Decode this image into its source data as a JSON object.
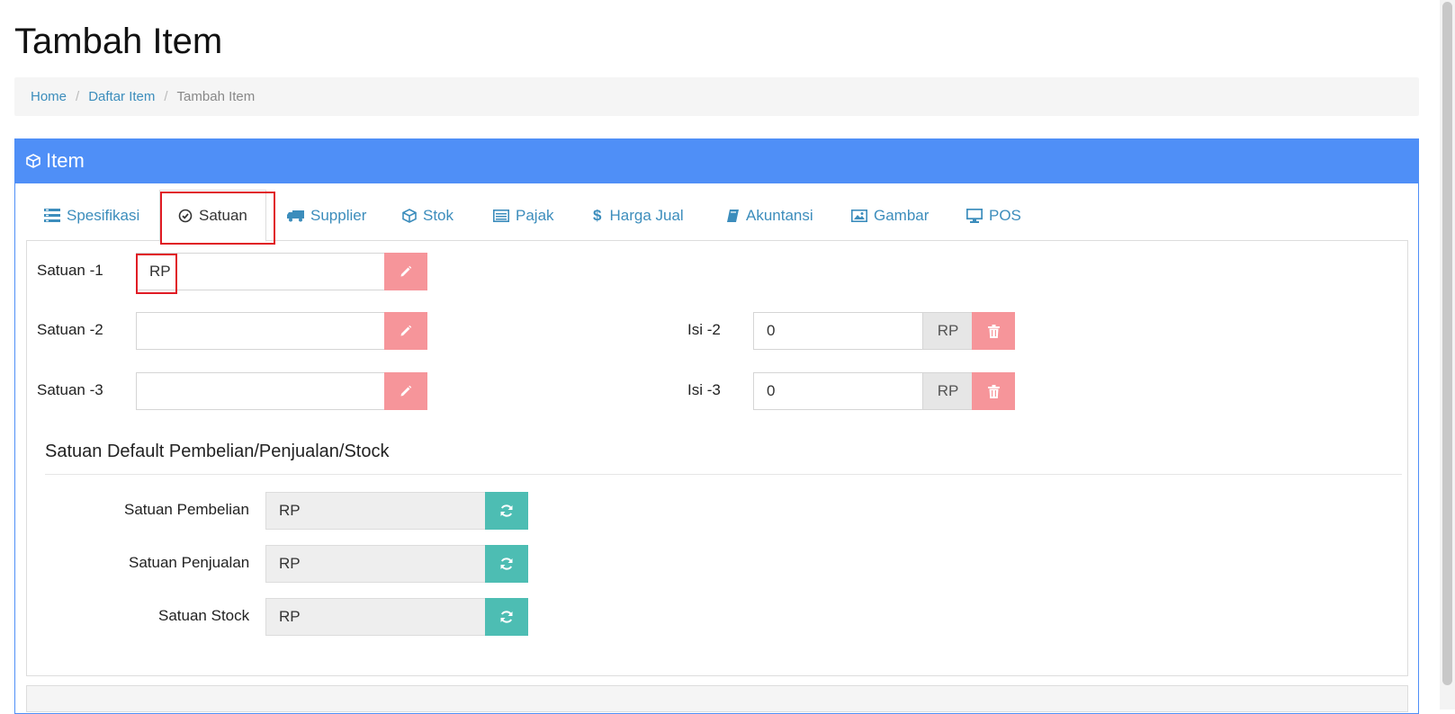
{
  "page": {
    "title": "Tambah Item"
  },
  "breadcrumb": {
    "items": [
      "Home",
      "Daftar Item"
    ],
    "current": "Tambah Item"
  },
  "panel": {
    "title": "Item",
    "header_color": "#4f8ff7"
  },
  "tabs": [
    {
      "label": "Spesifikasi",
      "icon": "list-icon"
    },
    {
      "label": "Satuan",
      "icon": "check-circle-icon",
      "active": true
    },
    {
      "label": "Supplier",
      "icon": "truck-icon"
    },
    {
      "label": "Stok",
      "icon": "cube-icon"
    },
    {
      "label": "Pajak",
      "icon": "list-alt-icon"
    },
    {
      "label": "Harga Jual",
      "icon": "dollar-icon"
    },
    {
      "label": "Akuntansi",
      "icon": "book-icon"
    },
    {
      "label": "Gambar",
      "icon": "picture-icon"
    },
    {
      "label": "POS",
      "icon": "monitor-icon"
    }
  ],
  "units": {
    "satuan1": {
      "label": "Satuan -1",
      "value": "RP"
    },
    "satuan2": {
      "label": "Satuan -2",
      "value": "",
      "isi_label": "Isi -2",
      "isi_value": "0",
      "isi_unit": "RP"
    },
    "satuan3": {
      "label": "Satuan -3",
      "value": "",
      "isi_label": "Isi -3",
      "isi_value": "0",
      "isi_unit": "RP"
    }
  },
  "defaults": {
    "title": "Satuan Default Pembelian/Penjualan/Stock",
    "pembelian": {
      "label": "Satuan Pembelian",
      "value": "RP"
    },
    "penjualan": {
      "label": "Satuan Penjualan",
      "value": "RP"
    },
    "stock": {
      "label": "Satuan Stock",
      "value": "RP"
    }
  },
  "colors": {
    "link": "#3c8dbc",
    "danger_button": "#f6959a",
    "refresh_button": "#4dbdb3",
    "highlight": "#e01b24"
  }
}
